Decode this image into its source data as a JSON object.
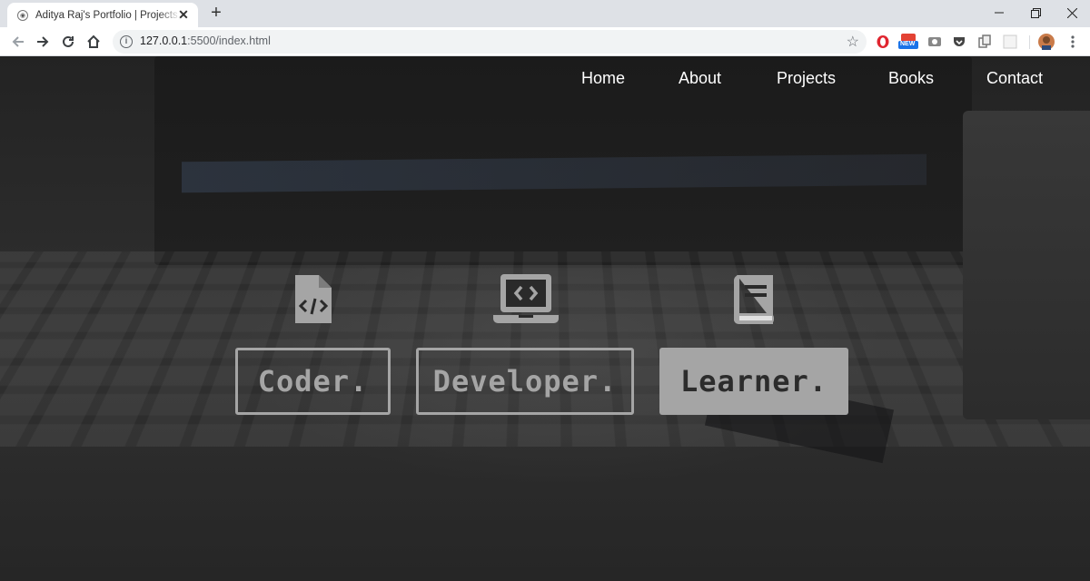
{
  "browser": {
    "tab_title": "Aditya Raj's Portfolio | Projects, B",
    "url_host": "127.0.0.1",
    "url_rest": ":5500/index.html",
    "extension_badge": "NEW",
    "icons": [
      "back-arrow",
      "forward-arrow",
      "reload",
      "home",
      "info",
      "star",
      "opera",
      "mail-new",
      "vpn",
      "pocket",
      "copy",
      "blank-ext",
      "profile-avatar",
      "kebab-menu",
      "minimize",
      "restore",
      "close"
    ]
  },
  "nav": {
    "items": [
      {
        "label": "Home"
      },
      {
        "label": "About"
      },
      {
        "label": "Projects"
      },
      {
        "label": "Books"
      },
      {
        "label": "Contact"
      }
    ]
  },
  "hero": {
    "cards": [
      {
        "label": "Coder.",
        "icon": "file-code-icon",
        "style": "outline"
      },
      {
        "label": "Developer.",
        "icon": "laptop-code-icon",
        "style": "outline"
      },
      {
        "label": "Learner.",
        "icon": "book-icon",
        "style": "filled"
      }
    ]
  },
  "colors": {
    "pill": "#a5a5a5",
    "nav_text": "#ffffff",
    "overlay_bg": "#262626"
  }
}
